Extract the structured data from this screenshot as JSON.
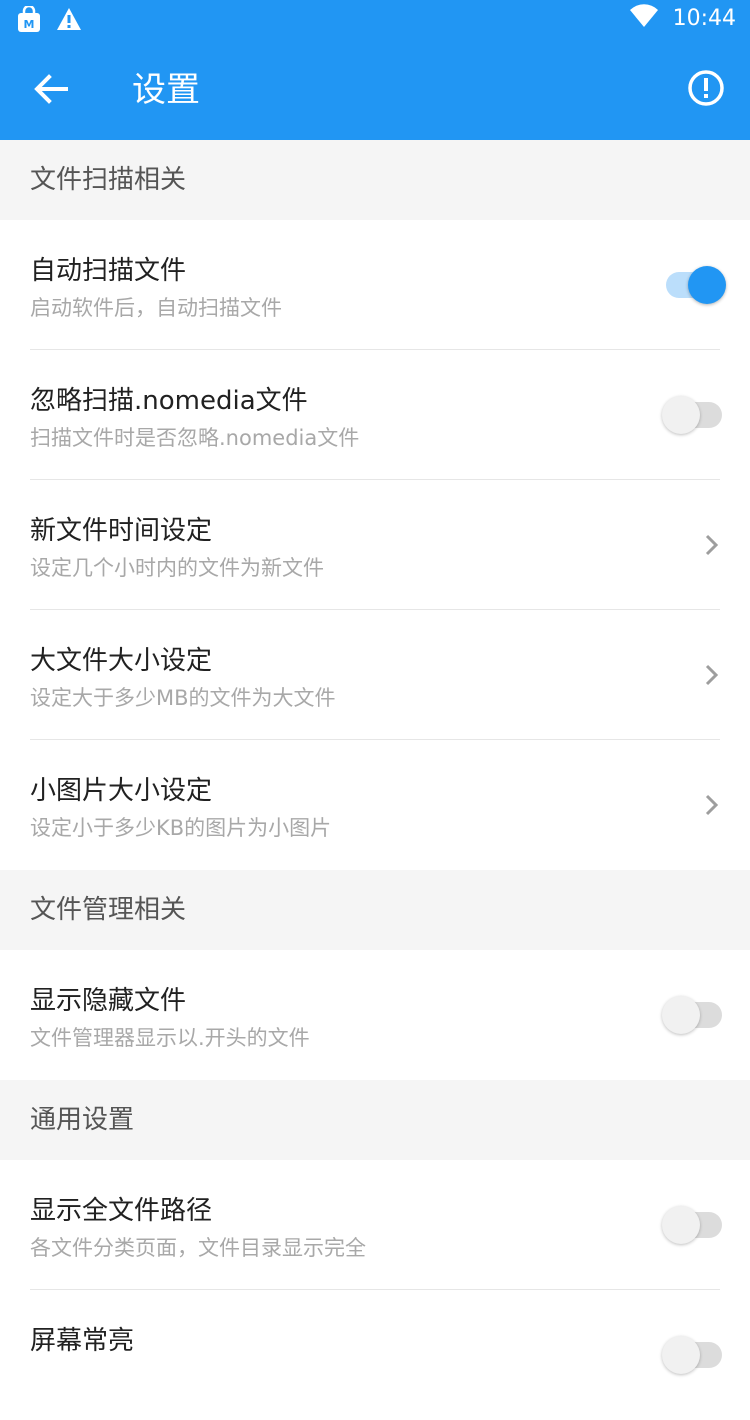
{
  "status_bar": {
    "time": "10:44",
    "icons": [
      "store-icon",
      "warning-icon",
      "wifi-icon",
      "battery-icon"
    ]
  },
  "toolbar": {
    "title": "设置",
    "back_icon": "arrow-back-icon",
    "info_icon": "info-icon"
  },
  "colors": {
    "primary": "#2196f3",
    "section_bg": "#f5f5f5",
    "subtitle": "#a8a8a8"
  },
  "sections": [
    {
      "header": "文件扫描相关",
      "items": [
        {
          "title": "自动扫描文件",
          "subtitle": "启动软件后，自动扫描文件",
          "control": "switch",
          "checked": true
        },
        {
          "title": "忽略扫描.nomedia文件",
          "subtitle": "扫描文件时是否忽略.nomedia文件",
          "control": "switch",
          "checked": false
        },
        {
          "title": "新文件时间设定",
          "subtitle": "设定几个小时内的文件为新文件",
          "control": "chevron"
        },
        {
          "title": "大文件大小设定",
          "subtitle": "设定大于多少MB的文件为大文件",
          "control": "chevron"
        },
        {
          "title": "小图片大小设定",
          "subtitle": "设定小于多少KB的图片为小图片",
          "control": "chevron"
        }
      ]
    },
    {
      "header": "文件管理相关",
      "items": [
        {
          "title": "显示隐藏文件",
          "subtitle": "文件管理器显示以.开头的文件",
          "control": "switch",
          "checked": false
        }
      ]
    },
    {
      "header": "通用设置",
      "items": [
        {
          "title": "显示全文件路径",
          "subtitle": "各文件分类页面，文件目录显示完全",
          "control": "switch",
          "checked": false
        },
        {
          "title": "屏幕常亮",
          "subtitle": "",
          "control": "switch",
          "checked": false
        }
      ]
    }
  ]
}
